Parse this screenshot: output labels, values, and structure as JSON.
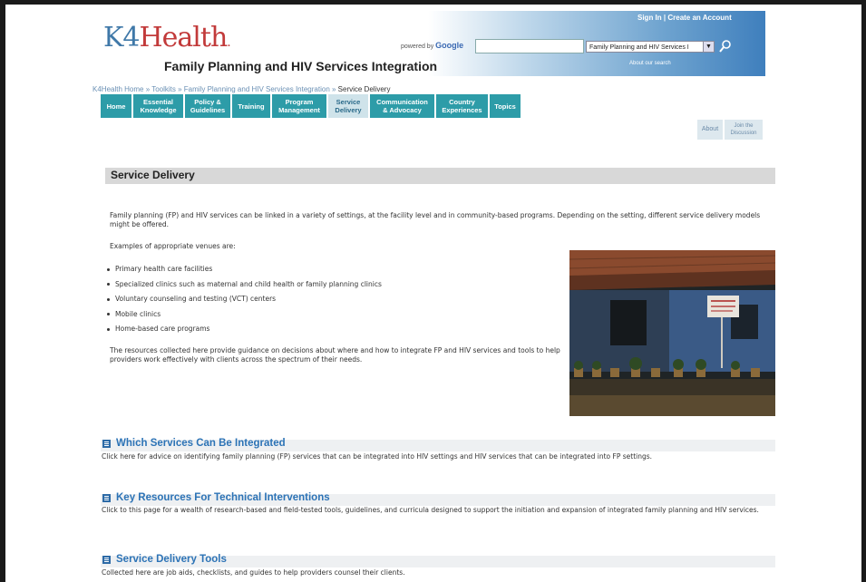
{
  "header": {
    "logo_k4": "K4",
    "logo_health": "Health",
    "site_title": "Family Planning and HIV Services Integration",
    "powered_by": "powered by",
    "powered_brand": "Google",
    "signin_text": "Sign In  |  Create an Account",
    "about_search": "About our search",
    "search_placeholder": "",
    "scope_selected": "Family Planning and HIV Services I"
  },
  "breadcrumb": {
    "path": "K4Health Home » Toolkits » Family Planning and HIV Services Integration » ",
    "current": "Service Delivery"
  },
  "nav": {
    "tabs": [
      {
        "label": "Home"
      },
      {
        "label": "Essential\nKnowledge"
      },
      {
        "label": "Policy &\nGuidelines"
      },
      {
        "label": "Training"
      },
      {
        "label": "Program\nManagement"
      },
      {
        "label": "Service\nDelivery",
        "active": true
      },
      {
        "label": "Communication\n& Advocacy"
      },
      {
        "label": "Country\nExperiences"
      },
      {
        "label": "Topics"
      }
    ],
    "about": "About",
    "join": "Join the\nDiscussion"
  },
  "section": {
    "title": "Service Delivery",
    "intro": "Family planning (FP) and HIV services can be linked in a variety of settings, at the facility level and in community-based programs. Depending on the setting, different service delivery models might be offered.",
    "examples_label": "Examples of appropriate venues are:",
    "venues": [
      "Primary health care facilities",
      "Specialized clinics such as maternal and child health or family planning clinics",
      "Voluntary counseling and testing (VCT) centers",
      "Mobile clinics",
      "Home-based care programs"
    ],
    "resources": "The resources collected here provide guidance on decisions about where and how to integrate FP and HIV services and tools to help providers work effectively with clients across the spectrum of their needs."
  },
  "links": [
    {
      "title": "Which Services Can Be Integrated",
      "desc": "Click here for advice on identifying family planning (FP) services that can be integrated into HIV settings and HIV services that can be integrated into FP settings."
    },
    {
      "title": "Key Resources For Technical Interventions",
      "desc": "Click to this page for a wealth of research-based and field-tested tools, guidelines, and curricula designed to support the initiation and expansion of integrated family planning and HIV services."
    },
    {
      "title": "Service Delivery Tools",
      "desc": "Collected here are job aids, checklists, and guides to help providers counsel their clients."
    }
  ],
  "colors": {
    "tab": "#2d9ca8",
    "tab_active": "#cfe3ea",
    "link": "#2c73b6",
    "header_blue": "#3f7fbd"
  }
}
